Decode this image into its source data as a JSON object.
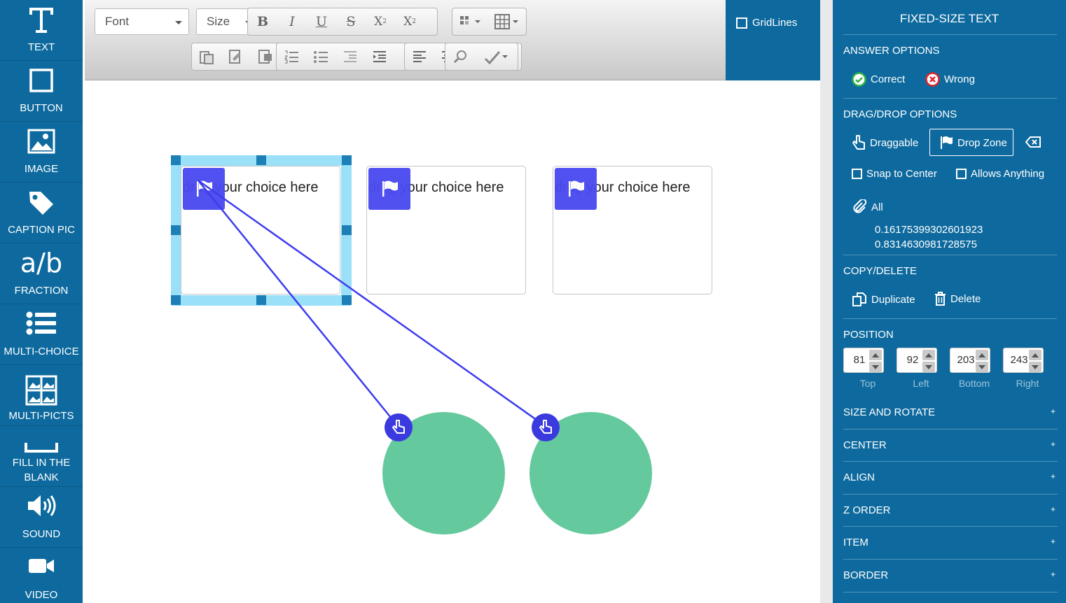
{
  "tools": [
    {
      "label": "TEXT",
      "icon": "text-icon"
    },
    {
      "label": "BUTTON",
      "icon": "square-icon"
    },
    {
      "label": "IMAGE",
      "icon": "image-icon"
    },
    {
      "label": "CAPTION PIC",
      "icon": "tag-icon"
    },
    {
      "label": "FRACTION",
      "icon": "fraction-icon",
      "glyph": "a/b"
    },
    {
      "label": "MULTI-CHOICE",
      "icon": "list-icon"
    },
    {
      "label": "MULTI-PICTS",
      "icon": "picture-grid-icon"
    },
    {
      "label": "FILL IN THE",
      "label2": "BLANK",
      "icon": "blank-line-icon"
    },
    {
      "label": "SOUND",
      "icon": "speaker-icon"
    },
    {
      "label": "VIDEO",
      "icon": "video-camera-icon"
    }
  ],
  "toolbar": {
    "font_select": "Font",
    "size_select": "Size",
    "bold": "B",
    "italic": "I",
    "underline": "U",
    "strike": "S",
    "subscript": "X",
    "superscript": "X",
    "gridlines_label": "GridLines"
  },
  "canvas": {
    "drop_text": "drag your choice here"
  },
  "panel": {
    "title": "FIXED-SIZE TEXT",
    "answer_options": "ANSWER OPTIONS",
    "correct": "Correct",
    "wrong": "Wrong",
    "dragdrop_options": "DRAG/DROP OPTIONS",
    "draggable": "Draggable",
    "drop_zone": "Drop Zone",
    "snap_to_center": "Snap to Center",
    "allows_anything": "Allows Anything",
    "all": "All",
    "value1": "0.16175399302601923",
    "value2": "0.8314630981728575",
    "copy_delete": "COPY/DELETE",
    "duplicate": "Duplicate",
    "delete": "Delete",
    "position": "POSITION",
    "pos_values": {
      "top": "81",
      "left": "92",
      "bottom": "203",
      "right": "243"
    },
    "pos_labels": {
      "top": "Top",
      "left": "Left",
      "bottom": "Bottom",
      "right": "Right"
    },
    "accordions": [
      "SIZE AND ROTATE",
      "CENTER",
      "ALIGN",
      "Z ORDER",
      "ITEM",
      "BORDER"
    ],
    "plus": "+"
  },
  "colors": {
    "brand": "#0e6a9e",
    "drop_flag": "#4a4af0",
    "connector": "#3c3cf0",
    "circle": "#64c99c",
    "selection": "#9ae0f9"
  }
}
